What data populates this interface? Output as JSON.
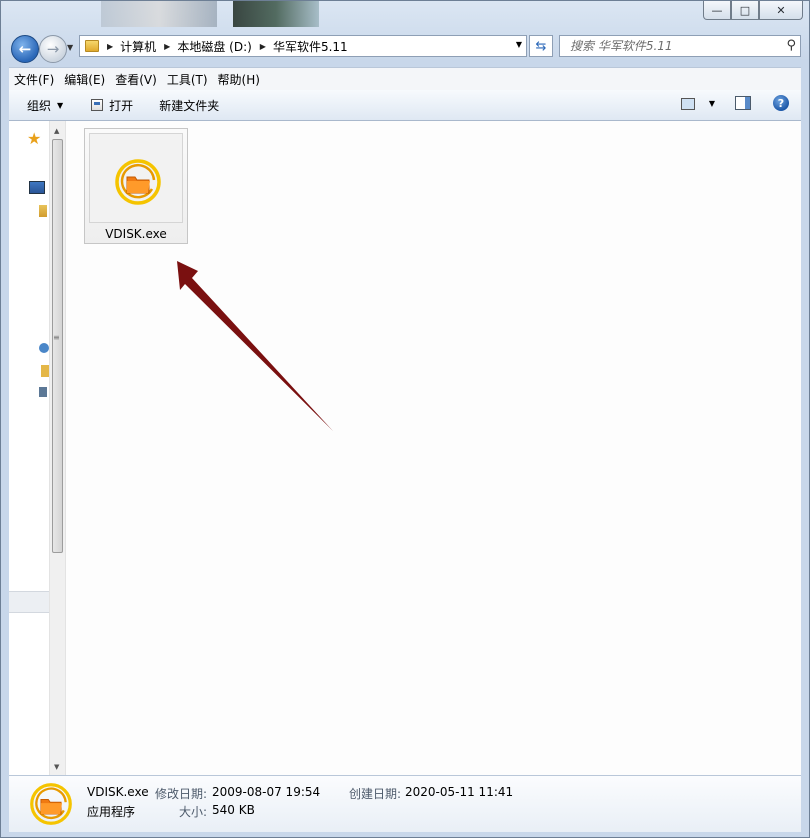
{
  "window": {
    "caption": {
      "min": "—",
      "max": "□",
      "close": "✕"
    }
  },
  "address": {
    "crumbs": [
      "计算机",
      "本地磁盘 (D:)",
      "华军软件5.11"
    ]
  },
  "search": {
    "placeholder": "搜索 华军软件5.11"
  },
  "menu": [
    "文件(F)",
    "编辑(E)",
    "查看(V)",
    "工具(T)",
    "帮助(H)"
  ],
  "toolbar": {
    "organize": "组织",
    "open": "打开",
    "new_folder": "新建文件夹"
  },
  "files": [
    {
      "name": "VDISK.exe",
      "icon": "vdisk-app-icon"
    }
  ],
  "details": {
    "name": "VDISK.exe",
    "type": "应用程序",
    "modified_label": "修改日期:",
    "modified_value": "2009-08-07 19:54",
    "created_label": "创建日期:",
    "created_value": "2020-05-11 11:41",
    "size_label": "大小:",
    "size_value": "540 KB"
  },
  "colors": {
    "accent_blue": "#2a67b8",
    "arrow": "#7a1010",
    "icon_orange": "#f07a12",
    "icon_ring": "#f5c400"
  }
}
